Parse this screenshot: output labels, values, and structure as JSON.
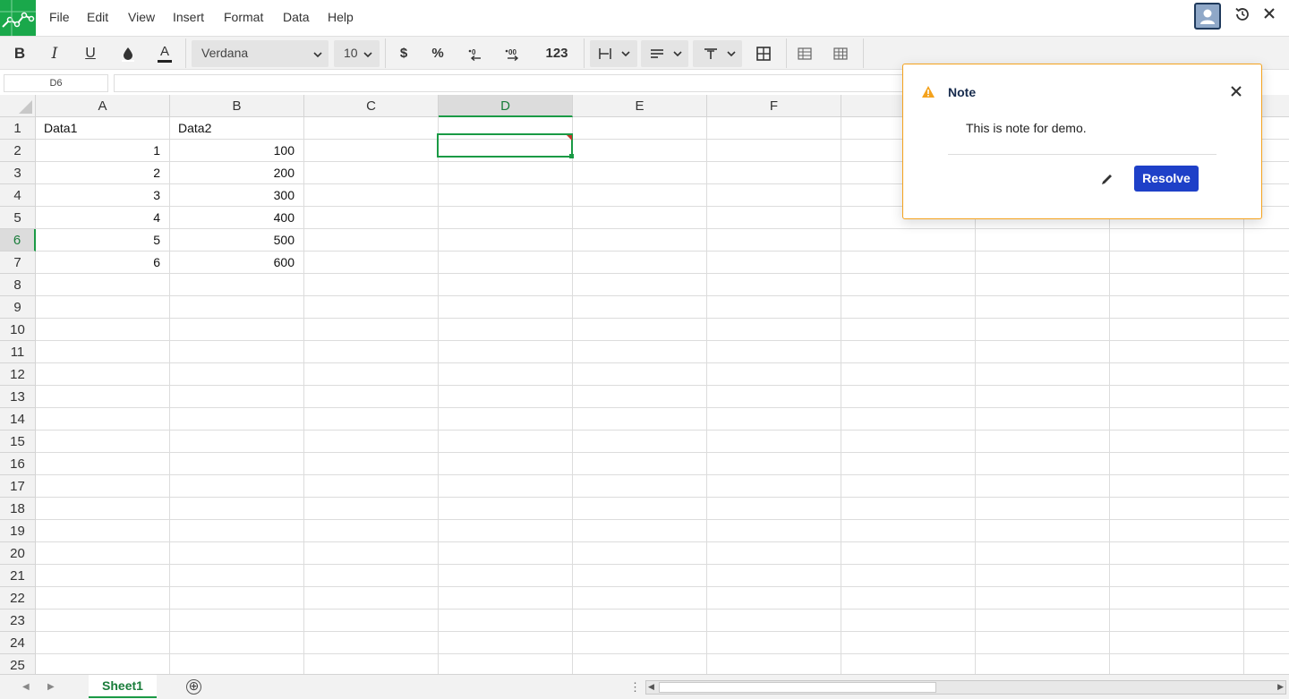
{
  "menu": {
    "items": [
      "File",
      "Edit",
      "View",
      "Insert",
      "Format",
      "Data",
      "Help"
    ]
  },
  "toolbar": {
    "bold": "B",
    "italic": "I",
    "underline": "U",
    "text_color": "A",
    "font": "Verdana",
    "font_size": "10",
    "currency": "$",
    "percent": "%",
    "number_format": "123"
  },
  "formula_bar": {
    "name_box": "D6",
    "formula": ""
  },
  "grid": {
    "columns": [
      "A",
      "B",
      "C",
      "D",
      "E",
      "F"
    ],
    "rows": [
      "1",
      "2",
      "3",
      "4",
      "5",
      "6",
      "7",
      "8",
      "9",
      "10",
      "11",
      "12",
      "13",
      "14",
      "15",
      "16",
      "17",
      "18",
      "19",
      "20",
      "21",
      "22",
      "23",
      "24",
      "25"
    ],
    "selected_column": "D",
    "selected_row": "6",
    "cells": {
      "A1": "Data1",
      "B1": "Data2",
      "A2": "1",
      "B2": "100",
      "A3": "2",
      "B3": "200",
      "A4": "3",
      "B4": "300",
      "A5": "4",
      "B5": "400",
      "A6": "5",
      "B6": "500",
      "A7": "6",
      "B7": "600"
    }
  },
  "sheets": {
    "active": "Sheet1",
    "add": "⊕"
  },
  "note": {
    "title": "Note",
    "text": "This is note for demo.",
    "resolve_label": "Resolve"
  },
  "colors": {
    "accent_green": "#1a9a45",
    "note_border": "#f4a21d",
    "resolve_blue": "#1e40c8"
  }
}
